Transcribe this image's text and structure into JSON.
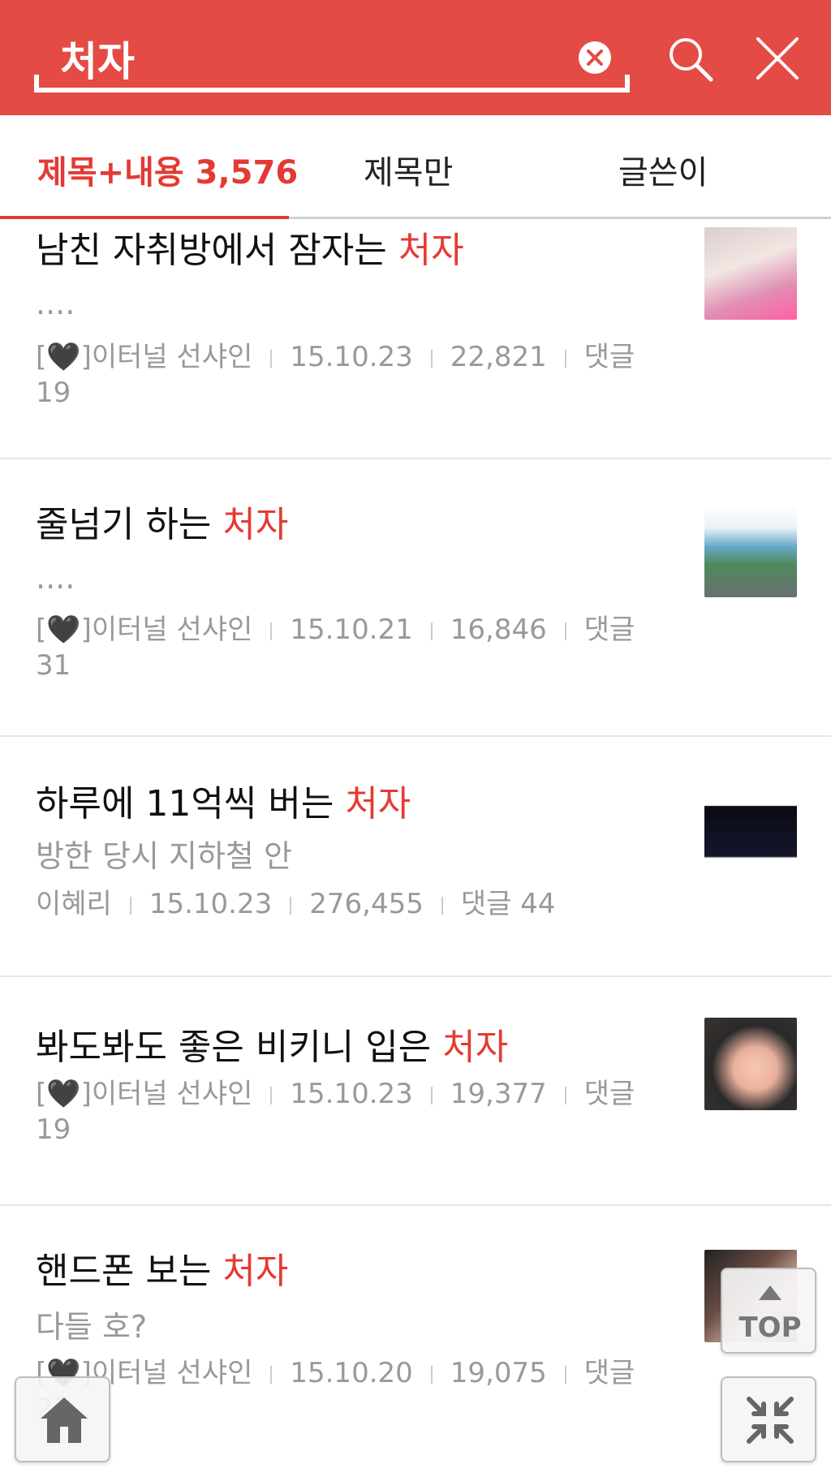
{
  "search": {
    "query": "처자"
  },
  "tabs": [
    {
      "label": "제목+내용 3,576",
      "active": true
    },
    {
      "label": "제목만",
      "active": false
    },
    {
      "label": "글쓴이",
      "active": false
    }
  ],
  "items": [
    {
      "title_pre": "남친 자취방에서 잠자는 ",
      "title_hl": "처자",
      "snippet": "....",
      "author": "[🖤]이터널 선샤인",
      "date": "15.10.23",
      "views": "22,821",
      "comments": "댓글 19",
      "thumb": "bed-photo"
    },
    {
      "title_pre": "줄넘기 하는 ",
      "title_hl": "처자",
      "snippet": "....",
      "author": "[🖤]이터널 선샤인",
      "date": "15.10.21",
      "views": "16,846",
      "comments": "댓글 31",
      "thumb": "beach-photo"
    },
    {
      "title_pre": "하루에 11억씩 버는 ",
      "title_hl": "처자",
      "snippet": "방한 당시 지하철 안",
      "author": "이혜리",
      "date": "15.10.23",
      "views": "276,455",
      "comments": "댓글 44",
      "thumb": "stage-photo"
    },
    {
      "title_pre": "봐도봐도 좋은 비키니 입은 ",
      "title_hl": "처자",
      "snippet": "",
      "author": "[🖤]이터널 선샤인",
      "date": "15.10.23",
      "views": "19,377",
      "comments": "댓글 19",
      "thumb": "bikini-photo"
    },
    {
      "title_pre": "핸드폰 보는 ",
      "title_hl": "처자",
      "snippet": "다들 호?",
      "author": "[🖤]이터널 선샤인",
      "date": "15.10.20",
      "views": "19,075",
      "comments": "댓글 22",
      "thumb": "phone-photo"
    }
  ],
  "buttons": {
    "top_label": "TOP"
  },
  "colors": {
    "header_bg": "#e44b45",
    "accent": "#e43a33",
    "meta_text": "#999999"
  },
  "icons": [
    "clear-icon",
    "search-icon",
    "close-icon",
    "arrow-up-icon",
    "home-icon",
    "collapse-icon"
  ]
}
